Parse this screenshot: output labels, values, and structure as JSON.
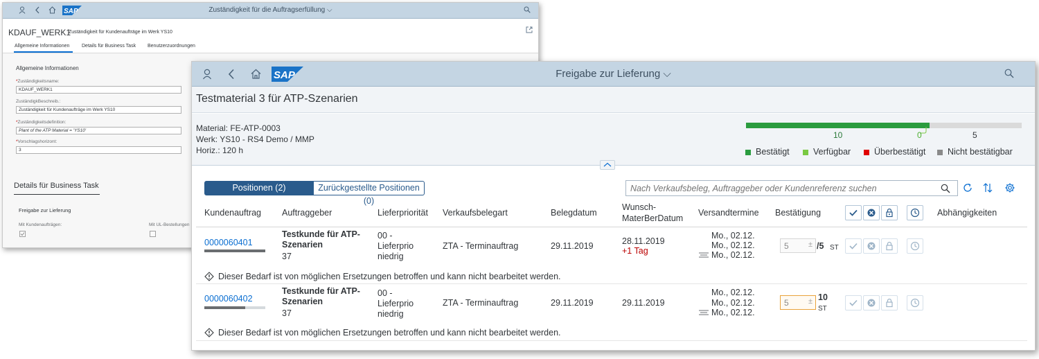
{
  "back_window": {
    "shell_title": "Zuständigkeit für die Auftragserfüllung",
    "object_title": "KDAUF_WERK1",
    "object_subtitle": "Zuständigkeit für Kundenaufträge im Werk YS10",
    "tabs": [
      "Allgemeine Informationen",
      "Details für Business Task",
      "Benutzerzuordnungen"
    ],
    "section_title": "Allgemeine Informationen",
    "fields": [
      {
        "label": "Zuständigkeitsname:",
        "required": "*",
        "value": "KDAUF_WERK1"
      },
      {
        "label": "ZuständigkBeschreib.:",
        "required": "",
        "value": "Zuständigkeit für Kundenaufträge im Werk YS10"
      },
      {
        "label": "Zuständigkeitsdefinition:",
        "required": "*",
        "value": "Plant of the ATP Material = 'YS10'"
      },
      {
        "label": "Vorschlagshorizont:",
        "required": "*",
        "value": "3"
      }
    ],
    "section2_title": "Details für Business Task",
    "subsection_title": "Freigabe zur Lieferung",
    "checkbox1_label": "Mit Kundenaufträgen:",
    "checkbox2_label": "Mit UL-Bestellungen"
  },
  "front_window": {
    "shell_title": "Freigabe zur Lieferung",
    "object_title": "Testmaterial 3 für ATP-Szenarien",
    "info_lines": [
      "Material: FE-ATP-0003",
      "Werk: YS10 - RS4 Demo / MMP",
      "Horiz.: 120 h"
    ],
    "quantity_bar": {
      "confirmed": 10,
      "available": 0,
      "not_confirmable": 5,
      "labels": [
        "10",
        "0",
        "5"
      ]
    },
    "legend": [
      {
        "label": "Bestätigt",
        "color": "#2b9c3f"
      },
      {
        "label": "Verfügbar",
        "color": "#7ac943"
      },
      {
        "label": "Überbestätigt",
        "color": "#e00000"
      },
      {
        "label": "Nicht bestätigbar",
        "color": "#8a8a8a"
      }
    ],
    "tabs": [
      {
        "label": "Positionen (2)",
        "active": true
      },
      {
        "label": "Zurückgestellte Positionen (0)",
        "active": false
      }
    ],
    "search_placeholder": "Nach Verkaufsbeleg, Auftraggeber oder Kundenreferenz suchen",
    "columns": [
      "Kundenauftrag",
      "Auftraggeber",
      "Lieferpriorität",
      "Verkaufsbelegart",
      "Belegdatum",
      "Wunsch-\nMaterBerDatum",
      "Versandtermine",
      "Bestätigung",
      "Abhängigkeiten"
    ],
    "rows": [
      {
        "order": "0000060401",
        "order_progress": 1.0,
        "customer": "Testkunde für ATP-\nSzenarien",
        "customer_no": "37",
        "priority": "00 -\nLieferprio\nniedrig",
        "doc_type": "ZTA - Terminauftrag",
        "doc_date": "29.11.2019",
        "wish_date": "28.11.2019",
        "wish_delta": "+1 Tag",
        "ship_dates": [
          "Mo., 02.12.",
          "Mo., 02.12.",
          "Mo., 02.12."
        ],
        "confirm_value": "5",
        "confirm_total": "/5",
        "unit": "ST",
        "note": "Dieser Bedarf ist von möglichen Ersetzungen betroffen und kann nicht bearbeitet werden."
      },
      {
        "order": "0000060402",
        "order_progress": 0.67,
        "customer": "Testkunde für ATP-\nSzenarien",
        "customer_no": "37",
        "priority": "00 -\nLieferprio\nniedrig",
        "doc_type": "ZTA - Terminauftrag",
        "doc_date": "29.11.2019",
        "wish_date": "29.11.2019",
        "wish_delta": "",
        "ship_dates": [
          "Mo., 02.12.",
          "Mo., 02.12.",
          "Mo., 02.12."
        ],
        "confirm_value": "5",
        "confirm_total": "10",
        "unit": "ST",
        "note": "Dieser Bedarf ist von möglichen Ersetzungen betroffen und kann nicht bearbeitet werden."
      }
    ]
  }
}
